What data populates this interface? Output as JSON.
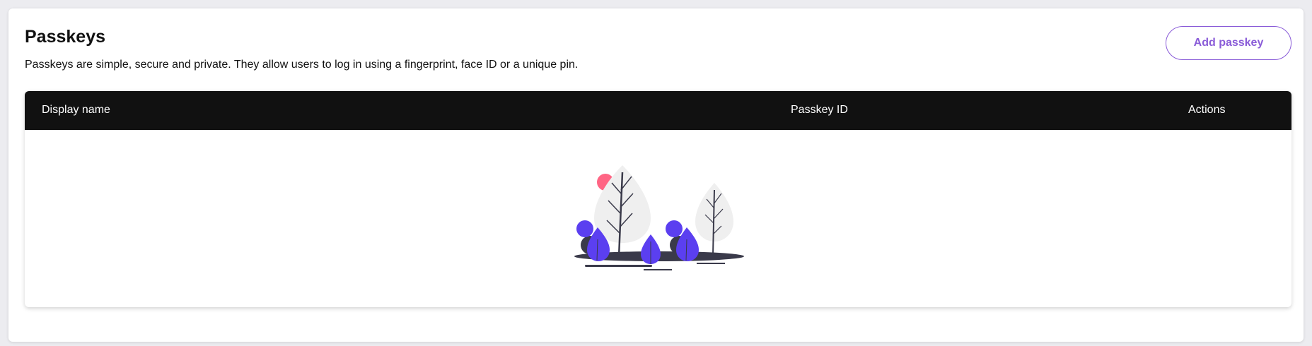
{
  "page": {
    "title": "Passkeys",
    "description": "Passkeys are simple, secure and private. They allow users to log in using a fingerprint, face ID or a unique pin.",
    "add_button_label": "Add passkey"
  },
  "table": {
    "columns": [
      "Display name",
      "Passkey ID",
      "Actions"
    ],
    "rows": []
  },
  "empty_state": {
    "illustration": "trees-empty-illustration-icon"
  },
  "colors": {
    "accent": "#8a5cd8",
    "header_bg": "#111111",
    "illustration_purple": "#5b3ff0",
    "illustration_pink": "#ff6584"
  }
}
